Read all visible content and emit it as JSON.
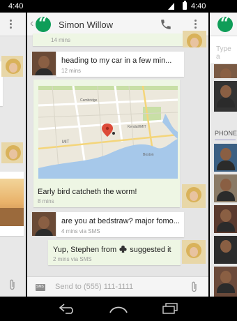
{
  "status_left": {
    "time": "4:40"
  },
  "status_right": {
    "time": "4:40"
  },
  "conversation": {
    "title": "Simon Willow",
    "messages": [
      {
        "text": "",
        "meta": "14 mins"
      },
      {
        "text": "heading to my car in a few min...",
        "meta": "12 mins"
      },
      {
        "text": "Early bird catcheth the worm!",
        "meta": "8 mins"
      },
      {
        "text": "are you at bedstraw? major fomo...",
        "meta": "4 mins via SMS"
      },
      {
        "text_before": "Yup, Stephen from",
        "text_after": "suggested it",
        "meta": "2 mins via SMS"
      }
    ],
    "compose_placeholder": "Send to (555) 111-1111"
  },
  "right_panel": {
    "search_placeholder": "Type a",
    "section_label": "PHONE"
  },
  "map": {
    "labels": [
      "MIT",
      "Kendall/MIT",
      "Cambridge",
      "Boston"
    ]
  },
  "colors": {
    "hangouts_green": "#0f9d58",
    "outgoing_bubble": "#eef6e4",
    "map_water": "#a6c8ea",
    "map_park": "#c8dfa6",
    "map_pin": "#dd4b39"
  },
  "icons": [
    "hangouts-icon",
    "phone-icon",
    "overflow-icon",
    "sms-icon",
    "paperclip-icon",
    "back-icon",
    "home-icon",
    "recents-icon",
    "club-icon"
  ]
}
